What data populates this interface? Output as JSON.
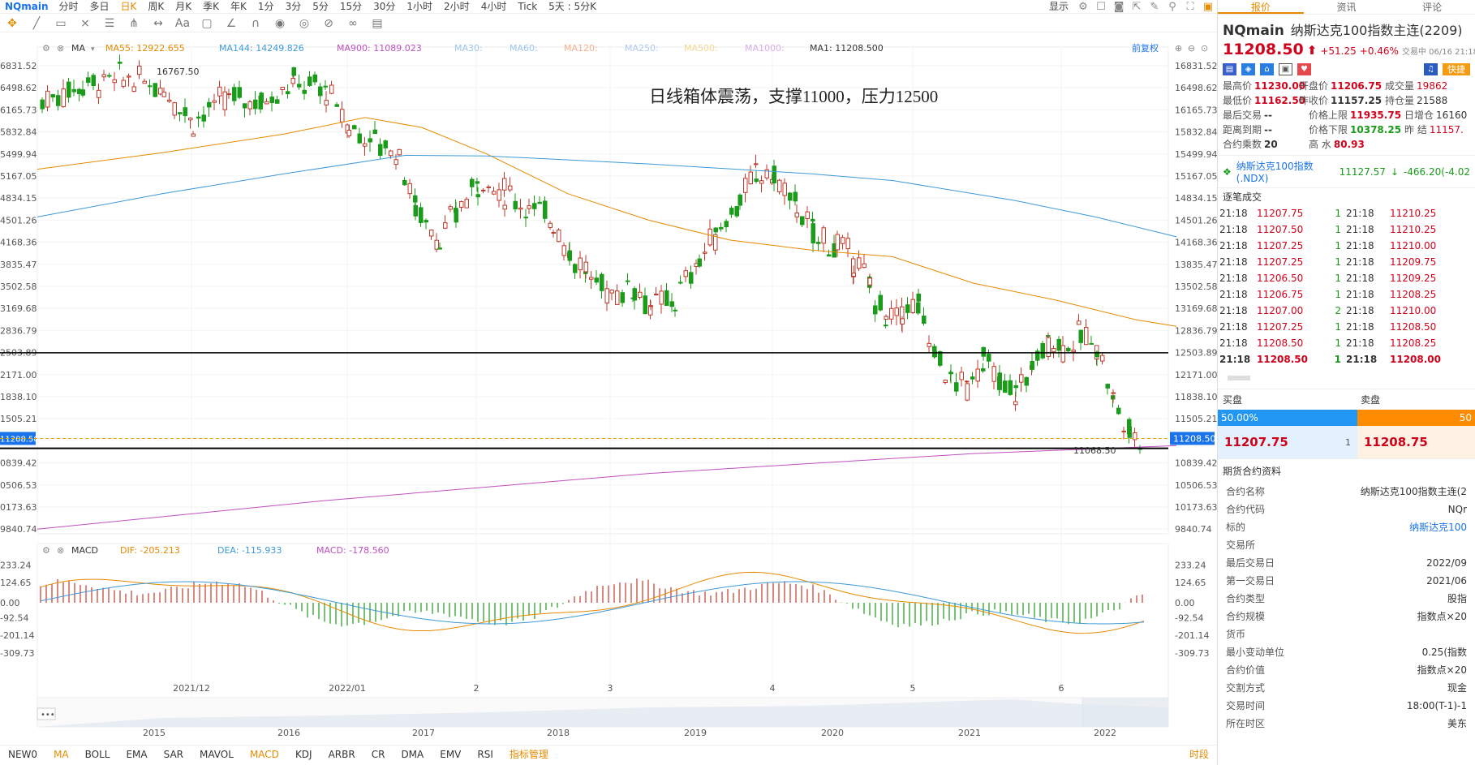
{
  "topbar": {
    "symbol": "NQmain",
    "timeframes": [
      "分时",
      "多日",
      "日K",
      "周K",
      "月K",
      "季K",
      "年K",
      "1分",
      "3分",
      "5分",
      "15分",
      "30分",
      "1小时",
      "2小时",
      "4小时",
      "Tick",
      "5天 : 5分K"
    ],
    "active_tf": "日K",
    "display_label": "显示"
  },
  "ma_legend": {
    "label": "MA",
    "items": [
      {
        "text": "MA55: 12922.655",
        "color": "#e68a00"
      },
      {
        "text": "MA144: 14249.826",
        "color": "#3d9ad8"
      },
      {
        "text": "MA900: 11089.023",
        "color": "#c050c0"
      },
      {
        "text": "MA30:",
        "color": "#9cc5ee"
      },
      {
        "text": "MA60:",
        "color": "#9cc5ee"
      },
      {
        "text": "MA120:",
        "color": "#f4b090"
      },
      {
        "text": "MA250:",
        "color": "#b0c8f0"
      },
      {
        "text": "MA500:",
        "color": "#f5d890"
      },
      {
        "text": "MA1000:",
        "color": "#d4b0e8"
      },
      {
        "text": "MA1: 11208.500",
        "color": "#333333"
      }
    ],
    "fuquan": "前复权"
  },
  "annotation": "日线箱体震荡，支撑11000，压力12500",
  "price_axis": [
    "16831.52",
    "16498.62",
    "16165.73",
    "15832.84",
    "15499.94",
    "15167.05",
    "14834.15",
    "14501.26",
    "14168.36",
    "13835.47",
    "13502.58",
    "13169.68",
    "12836.79",
    "12503.89",
    "12171.00",
    "11838.10",
    "11505.21",
    "11208.50",
    "10839.42",
    "10506.53",
    "10173.63",
    "9840.74"
  ],
  "left_axis": [
    "6831.52",
    "6498.62",
    "6165.73",
    "5832.84",
    "5499.94",
    "5167.05",
    "4834.15",
    "4501.26",
    "4168.36",
    "3835.47",
    "3502.58",
    "3169.68",
    "2836.79",
    "2503.89",
    "2171.00",
    "1838.10",
    "1505.21",
    "11208.50",
    "0839.42",
    "0506.53",
    "0173.63",
    "9840.74"
  ],
  "current_price": "11208.50",
  "high_label": "16767.50",
  "low_label": "11068.50",
  "macd_legend": {
    "label": "MACD",
    "dif": "DIF: -205.213",
    "dea": "DEA: -115.933",
    "macd": "MACD: -178.560"
  },
  "macd_axis": [
    "233.24",
    "124.65",
    "0.00",
    "-92.54",
    "-201.14",
    "-309.73"
  ],
  "macd_left_axis": [
    "233.24",
    "124.65",
    "0.00",
    "-92.54",
    "-201.14",
    "-309.73"
  ],
  "x_dates": [
    "2021/12",
    "2022/01",
    "2",
    "3",
    "4",
    "5",
    "6"
  ],
  "overview_years": [
    "2015",
    "2016",
    "2017",
    "2018",
    "2019",
    "2020",
    "2021",
    "2022"
  ],
  "indicators": [
    "NEW0",
    "MA",
    "BOLL",
    "EMA",
    "SAR",
    "MAVOL",
    "MACD",
    "KDJ",
    "ARBR",
    "CR",
    "DMA",
    "EMV",
    "RSI",
    "指标管理"
  ],
  "active_indicators": [
    "MA",
    "MACD"
  ],
  "shijian": "时段",
  "right": {
    "tabs": [
      "报价",
      "资讯",
      "评论"
    ],
    "title_code": "NQmain",
    "title_name": "纳斯达克100指数主连(2209)",
    "price": "11208.50",
    "change": "+51.25",
    "pct": "+0.46%",
    "time_note": "交易中 06/16 21:18",
    "quick_btn": "快捷",
    "stats": [
      [
        "最高价",
        "11230.00",
        "开盘价",
        "11206.75",
        "成交量",
        "19862"
      ],
      [
        "最低价",
        "11162.50",
        "昨收价",
        "11157.25",
        "持仓量",
        "21588"
      ],
      [
        "最后交易",
        "--",
        "价格上限",
        "11935.75",
        "日增仓",
        "16160"
      ],
      [
        "距离到期",
        "--",
        "价格下限",
        "10378.25",
        "昨  结",
        "11157."
      ],
      [
        "合约乘数",
        "20",
        "高  水",
        "80.93",
        "",
        ""
      ]
    ],
    "index_name": "纳斯达克100指数 (.NDX)",
    "index_price": "11127.57",
    "index_change": "-466.20(-4.02",
    "ticks_title": "逐笔成交",
    "ticks_left": [
      [
        "21:18",
        "11207.75",
        "1"
      ],
      [
        "21:18",
        "11207.50",
        "1"
      ],
      [
        "21:18",
        "11207.25",
        "1"
      ],
      [
        "21:18",
        "11207.25",
        "1"
      ],
      [
        "21:18",
        "11206.50",
        "1"
      ],
      [
        "21:18",
        "11206.75",
        "1"
      ],
      [
        "21:18",
        "11207.00",
        "2"
      ],
      [
        "21:18",
        "11207.25",
        "1"
      ],
      [
        "21:18",
        "11208.50",
        "1"
      ],
      [
        "21:18",
        "11208.50",
        "1"
      ]
    ],
    "ticks_right": [
      [
        "21:18",
        "11210.25"
      ],
      [
        "21:18",
        "11210.25"
      ],
      [
        "21:18",
        "11210.00"
      ],
      [
        "21:18",
        "11209.75"
      ],
      [
        "21:18",
        "11209.25"
      ],
      [
        "21:18",
        "11208.25"
      ],
      [
        "21:18",
        "11210.00"
      ],
      [
        "21:18",
        "11208.50"
      ],
      [
        "21:18",
        "11208.25"
      ],
      [
        "21:18",
        "11208.00"
      ]
    ],
    "buy_label": "买盘",
    "sell_label": "卖盘",
    "buy_pct": "50.00%",
    "sell_pct": "50",
    "bid": "11207.75",
    "bid_qty": "1",
    "ask": "11208.75",
    "contract_title": "期货合约资料",
    "contract": [
      [
        "合约名称",
        "纳斯达克100指数主连(2"
      ],
      [
        "合约代码",
        "NQr"
      ],
      [
        "标的",
        "纳斯达克100"
      ],
      [
        "交易所",
        ""
      ],
      [
        "最后交易日",
        "2022/09"
      ],
      [
        "第一交易日",
        "2021/06"
      ],
      [
        "合约类型",
        "股指"
      ],
      [
        "合约规模",
        "指数点×20"
      ],
      [
        "货币",
        ""
      ],
      [
        "最小变动单位",
        "0.25(指数"
      ],
      [
        "合约价值",
        "指数点×20"
      ],
      [
        "交割方式",
        "现金"
      ],
      [
        "交易时间",
        "18:00(T-1)-1"
      ],
      [
        "所在时区",
        "美东"
      ]
    ]
  }
}
